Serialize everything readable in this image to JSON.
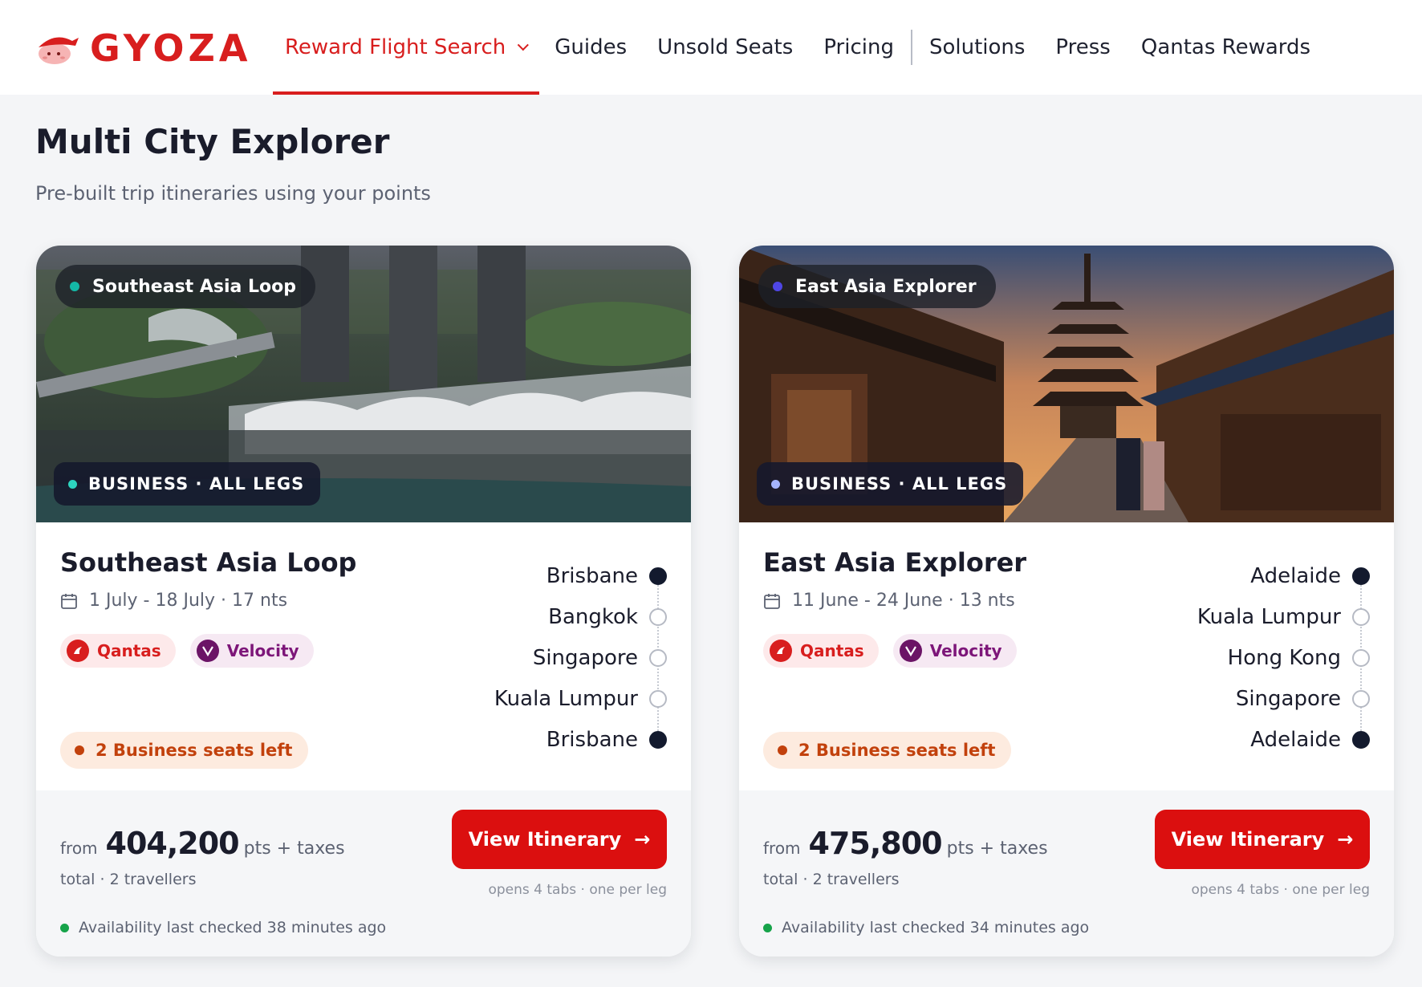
{
  "brand": {
    "name": "GYOZA",
    "color": "#d81e1e",
    "logo_icon": "gyoza-mascot-icon"
  },
  "nav": {
    "items": [
      {
        "label": "Reward Flight Search",
        "active": true,
        "has_dropdown": true
      },
      {
        "label": "Guides"
      },
      {
        "label": "Unsold Seats"
      },
      {
        "label": "Pricing"
      },
      {
        "label": "Solutions"
      },
      {
        "label": "Press"
      },
      {
        "label": "Qantas Rewards"
      }
    ]
  },
  "header": {
    "title": "Multi City Explorer",
    "subtitle": "Pre-built trip itineraries using your points"
  },
  "cards": [
    {
      "image": "singapore-marina-bay-aerial",
      "badge": {
        "label": "Southeast Asia Loop",
        "dot_color": "#14b8a6"
      },
      "cabin_badge": {
        "label": "BUSINESS · ALL LEGS",
        "dot_color": "#2dd4bf"
      },
      "title": "Southeast Asia Loop",
      "dates": "1 July - 18 July · 17 nts",
      "programs": [
        "Qantas",
        "Velocity"
      ],
      "seats_left": "2 Business seats left",
      "route": [
        "Brisbane",
        "Bangkok",
        "Singapore",
        "Kuala Lumpur",
        "Brisbane"
      ],
      "price": {
        "from": "from",
        "value": "404,200",
        "unit": "pts + taxes",
        "total": "total · 2 travellers"
      },
      "cta": {
        "label": "View Itinerary",
        "note": "opens 4 tabs · one per leg"
      },
      "availability": "Availability last checked 38 minutes ago"
    },
    {
      "image": "kyoto-pagoda-street",
      "badge": {
        "label": "East Asia Explorer",
        "dot_color": "#4f46e5"
      },
      "cabin_badge": {
        "label": "BUSINESS · ALL LEGS",
        "dot_color": "#a5b4fc"
      },
      "title": "East Asia Explorer",
      "dates": "11 June - 24 June · 13 nts",
      "programs": [
        "Qantas",
        "Velocity"
      ],
      "seats_left": "2 Business seats left",
      "route": [
        "Adelaide",
        "Kuala Lumpur",
        "Hong Kong",
        "Singapore",
        "Adelaide"
      ],
      "price": {
        "from": "from",
        "value": "475,800",
        "unit": "pts + taxes",
        "total": "total · 2 travellers"
      },
      "cta": {
        "label": "View Itinerary",
        "note": "opens 4 tabs · one per leg"
      },
      "availability": "Availability last checked 34 minutes ago"
    }
  ]
}
